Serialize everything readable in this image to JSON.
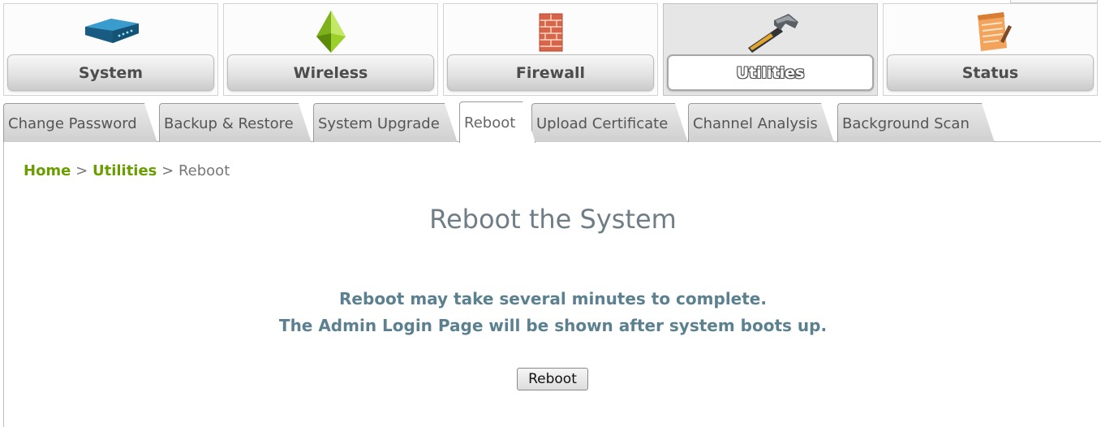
{
  "topnav": {
    "items": [
      {
        "label": "System",
        "icon": "router-icon",
        "active": false
      },
      {
        "label": "Wireless",
        "icon": "pyramid-icon",
        "active": false
      },
      {
        "label": "Firewall",
        "icon": "brick-wall-icon",
        "active": false
      },
      {
        "label": "Utilities",
        "icon": "hammer-icon",
        "active": true
      },
      {
        "label": "Status",
        "icon": "notepad-icon",
        "active": false
      }
    ]
  },
  "subtabs": {
    "items": [
      {
        "label": "Change Password",
        "active": false
      },
      {
        "label": "Backup & Restore",
        "active": false
      },
      {
        "label": "System Upgrade",
        "active": false
      },
      {
        "label": "Reboot",
        "active": true
      },
      {
        "label": "Upload Certificate",
        "active": false
      },
      {
        "label": "Channel Analysis",
        "active": false
      },
      {
        "label": "Background Scan",
        "active": false
      }
    ]
  },
  "breadcrumb": {
    "home": "Home",
    "sep1": ">",
    "section": "Utilities",
    "sep2": ">",
    "current": "Reboot"
  },
  "content": {
    "title": "Reboot the System",
    "line1": "Reboot may take several minutes to complete.",
    "line2": "The Admin Login Page will be shown after system boots up.",
    "reboot_button": "Reboot"
  },
  "colors": {
    "link_green": "#6a9e00",
    "title_gray": "#6f7d86",
    "message_blue": "#5b8090"
  }
}
